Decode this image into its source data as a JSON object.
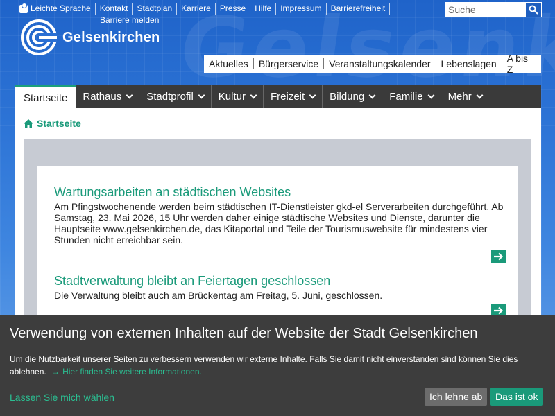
{
  "background": {
    "watermark": "Gelsenki"
  },
  "meta_nav": {
    "items": [
      "Leichte Sprache",
      "Kontakt",
      "Stadtplan",
      "Karriere",
      "Presse",
      "Hilfe",
      "Impressum",
      "Barrierefreiheit"
    ],
    "second_line": "Barriere melden"
  },
  "search": {
    "placeholder": "Suche",
    "icon": "search-icon"
  },
  "logo": {
    "name": "Gelsenkirchen"
  },
  "service_nav": [
    "Aktuelles",
    "Bürgerservice",
    "Veranstaltungskalender",
    "Lebenslagen",
    "A bis Z"
  ],
  "main_nav": [
    {
      "label": "Startseite",
      "active": true
    },
    {
      "label": "Rathaus"
    },
    {
      "label": "Stadtprofil"
    },
    {
      "label": "Kultur"
    },
    {
      "label": "Freizeit"
    },
    {
      "label": "Bildung"
    },
    {
      "label": "Familie"
    },
    {
      "label": "Mehr"
    }
  ],
  "breadcrumb": {
    "label": "Startseite",
    "icon": "home-icon"
  },
  "news": [
    {
      "title": "Wartungsarbeiten an städtischen Websites",
      "text": "Am Pfingstwochenende werden beim städtischen IT-Dienstleister gkd-el Serverarbeiten durchgeführt. Ab Samstag, 23. Mai 2026, 15 Uhr werden daher einige städtische Websites und Dienste, darunter die Hauptseite www.gelsenkirchen.de, das Kitaportal und Teile der Tourismuswebsite für mindestens vier Stunden nicht erreichbar sein."
    },
    {
      "title": "Stadtverwaltung bleibt an Feiertagen geschlossen",
      "text": "Die Verwaltung bleibt auch am Brückentag am Freitag, 5. Juni, geschlossen."
    }
  ],
  "cookie": {
    "title": "Verwendung von externen Inhalten auf der Website der Stadt Gelsenkirchen",
    "text": "Um die Nutzbarkeit unserer Seiten zu verbessern verwenden wir externe Inhalte. Falls Sie damit nicht einverstanden sind können Sie dies ablehnen.",
    "more_link": "Hier finden Sie weitere Informationen.",
    "choose": "Lassen Sie mich wählen",
    "reject": "Ich lehne ab",
    "accept": "Das ist ok"
  },
  "colors": {
    "accent": "#1a9a7a",
    "nav_bg": "#3a3a3a",
    "banner_bg": "#3d3d3d",
    "page_blue": "#2d74d6"
  }
}
